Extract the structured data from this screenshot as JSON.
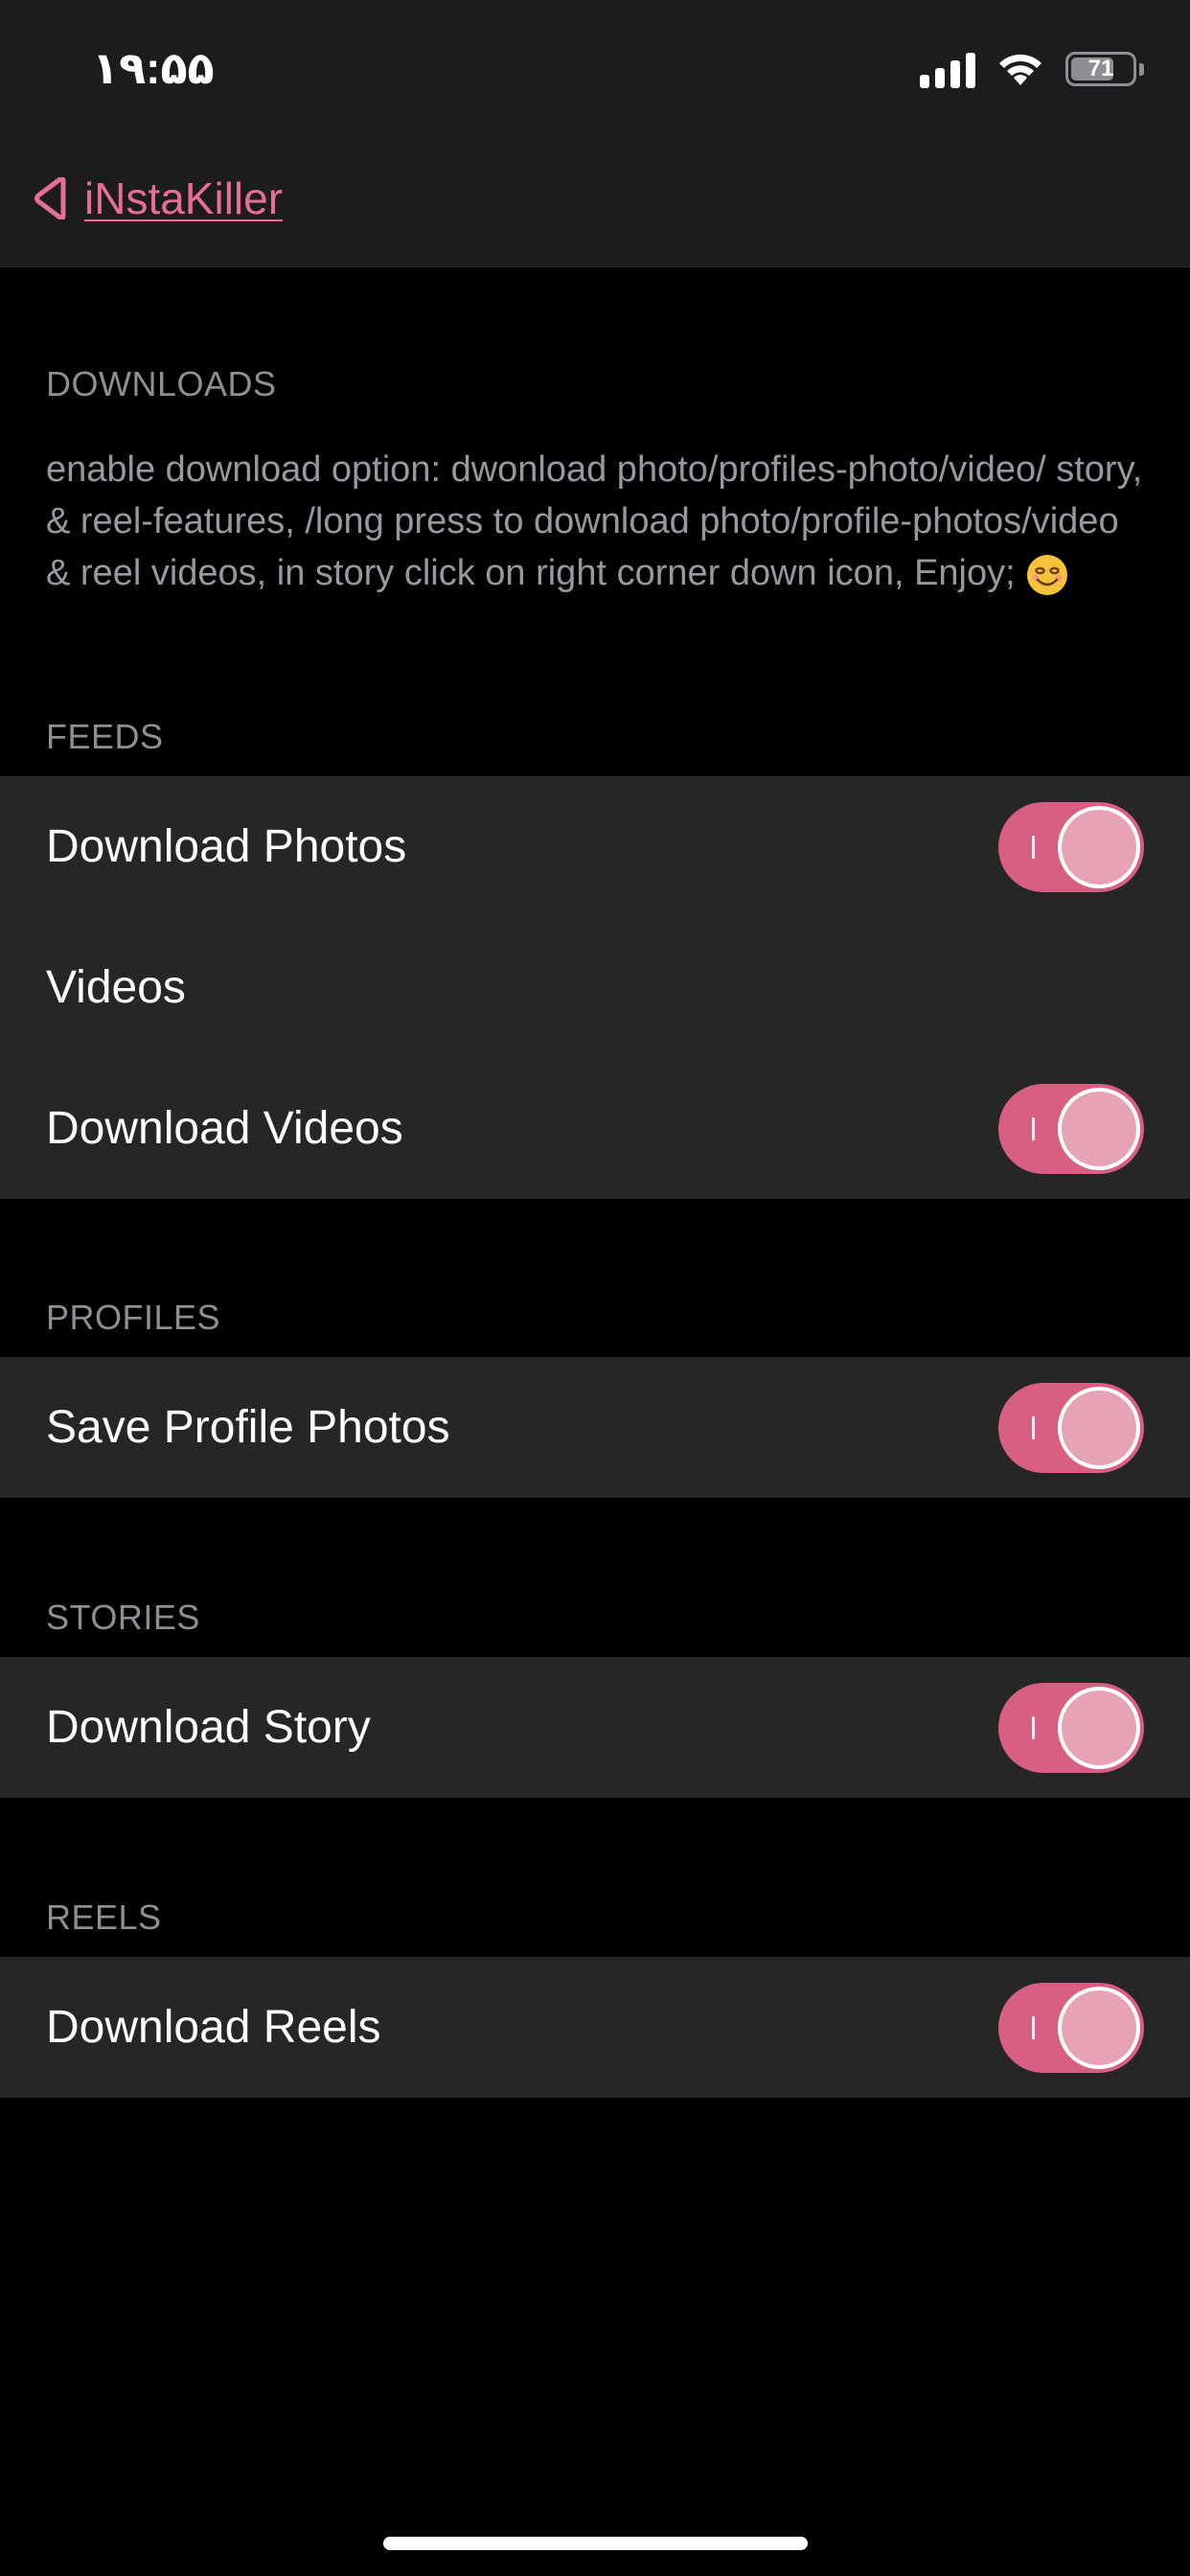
{
  "status_bar": {
    "time": "۱۹:۵۵",
    "battery": "71",
    "battery_level": 0.71
  },
  "nav": {
    "back_label": "iNstaKiller",
    "accent_color": "#e66f92"
  },
  "sections": {
    "downloads": {
      "header": "DOWNLOADS",
      "description": "enable download option: dwonload photo/profiles-photo/video/ story, & reel-features, /long press to download photo/profile-photos/video & reel videos, in story click on right corner down icon, Enjoy;"
    },
    "feeds": {
      "header": "FEEDS",
      "download_photos": {
        "label": "Download Photos",
        "on": true
      },
      "videos_label": "Videos",
      "download_videos": {
        "label": "Download Videos",
        "on": true
      }
    },
    "profiles": {
      "header": "PROFILES",
      "save_profile_photos": {
        "label": "Save Profile Photos",
        "on": true
      }
    },
    "stories": {
      "header": "STORIES",
      "download_story": {
        "label": "Download Story",
        "on": true
      }
    },
    "reels": {
      "header": "REELS",
      "download_reels": {
        "label": "Download Reels",
        "on": true
      }
    }
  },
  "colors": {
    "toggle_on": "#d85f82",
    "background": "#000000",
    "cell_background": "#262628",
    "section_header": "#8e8e93"
  }
}
